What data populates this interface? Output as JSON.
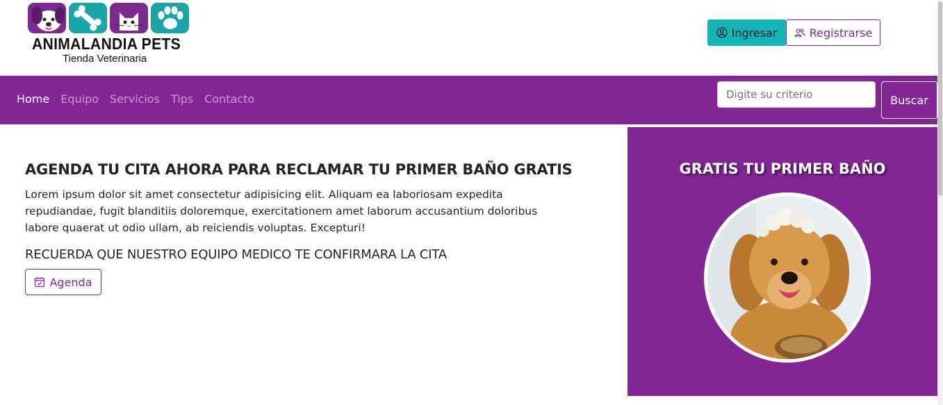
{
  "brand": {
    "name": "ANIMALANDIA PETS",
    "tagline": "Tienda Veterinaria",
    "colors": {
      "purple": "#832594",
      "teal": "#14b3b6"
    }
  },
  "header": {
    "login_label": "Ingresar",
    "login_icon": "user-circle-icon",
    "register_label": "Registrarse",
    "register_icon": "users-icon"
  },
  "nav": {
    "items": [
      {
        "label": "Home",
        "active": true
      },
      {
        "label": "Equipo",
        "active": false
      },
      {
        "label": "Servicios",
        "active": false
      },
      {
        "label": "Tips",
        "active": false
      },
      {
        "label": "Contacto",
        "active": false
      }
    ],
    "search": {
      "placeholder": "Digite su criterio",
      "value": "",
      "button_label": "Buscar"
    }
  },
  "main": {
    "headline": "AGENDA TU CITA AHORA PARA RECLAMAR TU PRIMER BAÑO GRATIS",
    "paragraph": "Lorem ipsum dolor sit amet consectetur adipisicing elit. Aliquam ea laboriosam expedita repudiandae, fugit blanditiis doloremque, exercitationem amet laborum accusantium doloribus labore quaerat ut odio ullam, ab reiciendis voluptas. Excepturi!",
    "subheading": "RECUERDA QUE NUESTRO EQUIPO MEDICO TE CONFIRMARA LA CITA",
    "agenda_button": "Agenda",
    "agenda_icon": "calendar-check-icon"
  },
  "promo": {
    "title": "GRATIS TU PRIMER BAÑO"
  }
}
